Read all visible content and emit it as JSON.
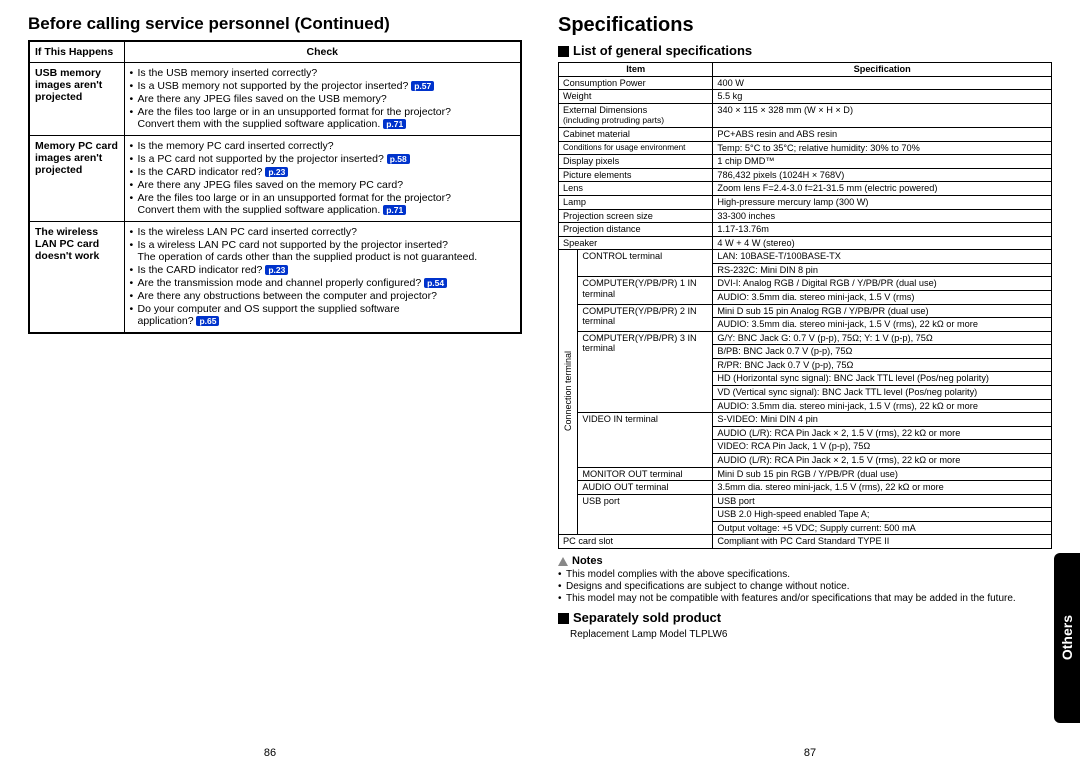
{
  "left": {
    "title": "Before calling service personnel (Continued)",
    "th1": "If  This Happens",
    "th2": "Check",
    "rows": {
      "r1_label": "USB memory images aren't projected",
      "r1_i1": "Is the USB memory inserted correctly?",
      "r1_i2": "Is a USB memory not supported by the projector inserted?",
      "r1_i2_ref": "p.57",
      "r1_i3": "Are there any JPEG files saved on the USB memory?",
      "r1_i4a": "Are the files too large or in an unsupported format for the projector?",
      "r1_i4b": "Convert them with the supplied software application.",
      "r1_i4_ref": "p.71",
      "r2_label": "Memory PC card images aren't projected",
      "r2_i1": "Is the memory PC card inserted correctly?",
      "r2_i2": "Is a PC card not supported by the projector inserted?",
      "r2_i2_ref": "p.58",
      "r2_i3": "Is the CARD indicator red?",
      "r2_i3_ref": "p.23",
      "r2_i4": "Are there any JPEG files saved on the memory PC card?",
      "r2_i5a": "Are the files too large or in an unsupported format for the projector?",
      "r2_i5b": "Convert them with the supplied software application.",
      "r2_i5_ref": "p.71",
      "r3_label": "The wireless LAN PC card doesn't work",
      "r3_i1": "Is the wireless LAN PC card inserted correctly?",
      "r3_i2a": "Is a wireless LAN PC card not supported by the projector inserted?",
      "r3_i2b": "The operation of cards other than the supplied product is not guaranteed.",
      "r3_i3": "Is the CARD indicator red?",
      "r3_i3_ref": "p.23",
      "r3_i4": "Are the transmission mode and channel properly configured?",
      "r3_i4_ref": "p.54",
      "r3_i5": "Are there any obstructions between the computer and projector?",
      "r3_i6a": "Do your computer and OS support the supplied software",
      "r3_i6b": "application?",
      "r3_i6_ref": "p.65"
    },
    "page": "86"
  },
  "right": {
    "title": "Specifications",
    "sec1": "List of general specifications",
    "th1": "Item",
    "th2": "Specification",
    "specs": {
      "s1l": "Consumption Power",
      "s1v": "400 W",
      "s2l": "Weight",
      "s2v": "5.5 kg",
      "s3l_a": "External Dimensions",
      "s3l_b": "(including protruding parts)",
      "s3v": "340 × 115 × 328 mm (W × H × D)",
      "s4l": "Cabinet material",
      "s4v": "PC+ABS resin and ABS resin",
      "s5l": "Conditions for usage environment",
      "s5v": "Temp: 5°C to 35°C; relative humidity: 30% to 70%",
      "s6l": "Display pixels",
      "s6v": "1 chip DMD™",
      "s7l": "Picture elements",
      "s7v": "786,432 pixels (1024H × 768V)",
      "s8l": "Lens",
      "s8v": "Zoom lens     F=2.4-3.0   f=21-31.5 mm (electric powered)",
      "s9l": "Lamp",
      "s9v": "High-pressure mercury lamp (300 W)",
      "s10l": "Projection screen size",
      "s10v": "33-300 inches",
      "s11l": "Projection distance",
      "s11v": "1.17-13.76m",
      "s12l": "Speaker",
      "s12v": "4 W + 4 W (stereo)",
      "vert": "Connection terminal",
      "c1l": "CONTROL terminal",
      "c1v1": "LAN: 10BASE-T/100BASE-TX",
      "c1v2": "RS-232C: Mini DIN 8 pin",
      "c2l": "COMPUTER(Y/PB/PR) 1 IN terminal",
      "c2v1": "DVI-I: Analog RGB / Digital RGB / Y/PB/PR (dual use)",
      "c2v2": "AUDIO: 3.5mm dia. stereo mini-jack, 1.5 V (rms)",
      "c3l": "COMPUTER(Y/PB/PR) 2 IN terminal",
      "c3v1": "Mini D sub 15 pin  Analog RGB / Y/PB/PR (dual use)",
      "c3v2": "AUDIO: 3.5mm dia. stereo mini-jack, 1.5 V (rms), 22 kΩ or more",
      "c4l": "COMPUTER(Y/PB/PR) 3 IN terminal",
      "c4v1": "G/Y: BNC Jack  G: 0.7 V (p-p), 75Ω; Y: 1 V (p-p), 75Ω",
      "c4v2": "B/PB: BNC Jack  0.7 V (p-p), 75Ω",
      "c4v3": "R/PR: BNC Jack  0.7 V (p-p), 75Ω",
      "c4v4": "HD (Horizontal sync signal): BNC Jack  TTL level (Pos/neg polarity)",
      "c4v5": "VD (Vertical sync signal): BNC Jack  TTL level (Pos/neg polarity)",
      "c4v6": "AUDIO: 3.5mm dia. stereo mini-jack, 1.5 V (rms), 22 kΩ or more",
      "c5l": "VIDEO IN terminal",
      "c5v1": "S-VIDEO: Mini DIN 4 pin",
      "c5v2": "AUDIO (L/R): RCA Pin Jack × 2, 1.5 V (rms), 22 kΩ or more",
      "c5v3": "VIDEO: RCA Pin Jack, 1 V (p-p), 75Ω",
      "c5v4": "AUDIO (L/R): RCA Pin Jack × 2, 1.5 V (rms), 22 kΩ or more",
      "c6l": "MONITOR OUT terminal",
      "c6v": "Mini D sub 15 pin  RGB / Y/PB/PR (dual use)",
      "c7l": "AUDIO OUT terminal",
      "c7v": "3.5mm dia. stereo mini-jack, 1.5 V (rms), 22 kΩ or more",
      "c8l": "USB port",
      "c8v1": "USB port",
      "c8v2": "USB 2.0 High-speed enabled Tape A;",
      "c8v3": "Output voltage: +5 VDC; Supply current: 500 mA",
      "s13l": "PC card slot",
      "s13v": "Compliant with PC Card Standard TYPE II"
    },
    "notes_head": "Notes",
    "n1": "This model complies with the above specifications.",
    "n2": "Designs and specifications are subject to change without notice.",
    "n3": "This model may not be compatible with features and/or specifications that may be added in the future.",
    "sec2": "Separately sold product",
    "sep": "Replacement Lamp        Model TLPLW6",
    "page": "87",
    "tab": "Others"
  }
}
